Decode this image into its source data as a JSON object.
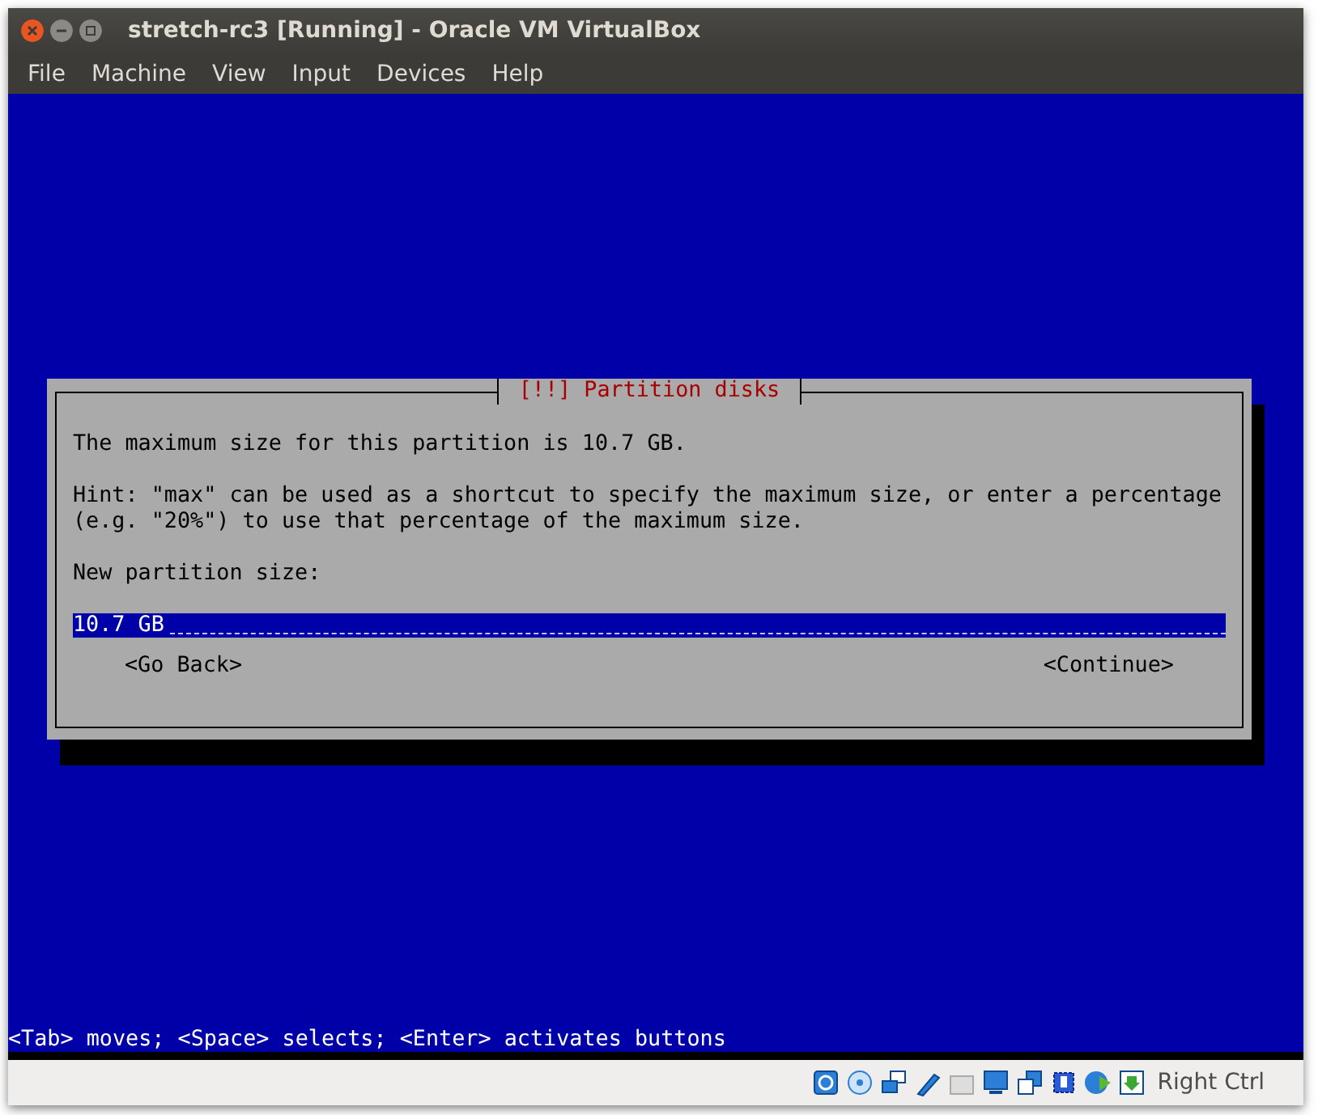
{
  "window": {
    "title": "stretch-rc3 [Running] - Oracle VM VirtualBox"
  },
  "menu": [
    "File",
    "Machine",
    "View",
    "Input",
    "Devices",
    "Help"
  ],
  "dialog": {
    "title": "[!!] Partition disks",
    "message": "The maximum size for this partition is 10.7 GB.",
    "hint": "Hint: \"max\" can be used as a shortcut to specify the maximum size, or enter a percentage\n(e.g. \"20%\") to use that percentage of the maximum size.",
    "field_label": "New partition size:",
    "field_value": "10.7 GB",
    "buttons": [
      "<Go Back>",
      "<Continue>"
    ]
  },
  "help_line": "<Tab> moves; <Space> selects; <Enter> activates buttons",
  "status_bar": {
    "host_key": "Right Ctrl"
  }
}
